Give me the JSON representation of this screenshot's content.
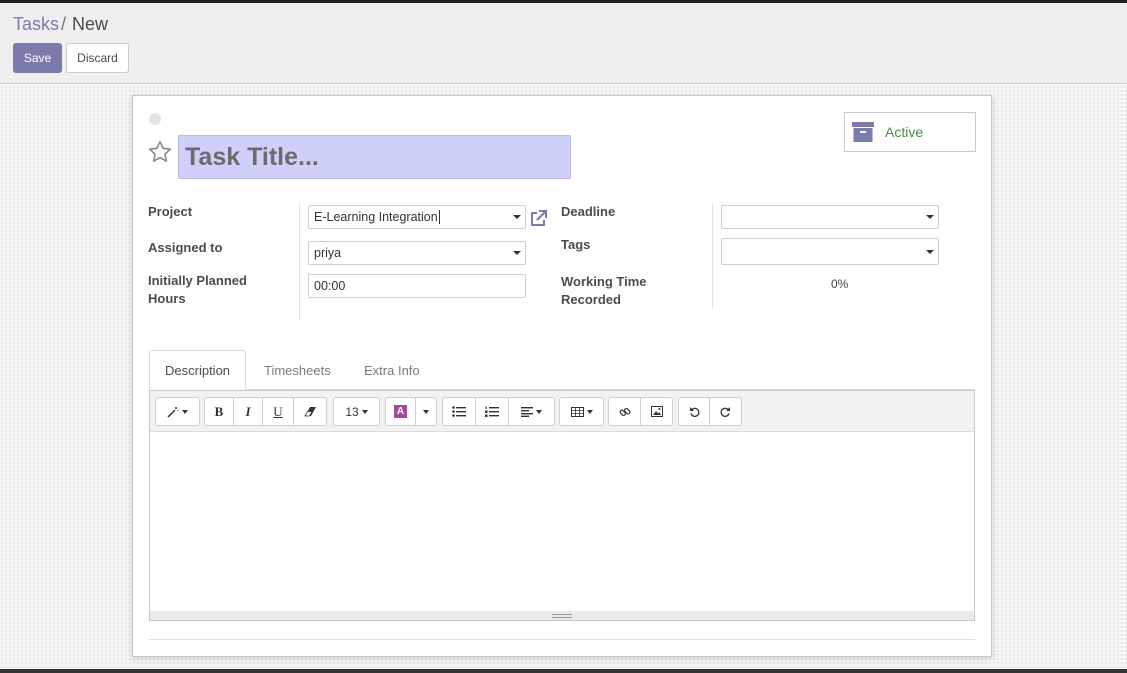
{
  "breadcrumb": {
    "parent": "Tasks",
    "separator": "/",
    "current": "New"
  },
  "buttons": {
    "save": "Save",
    "discard": "Discard"
  },
  "title": {
    "placeholder": "Task Title..."
  },
  "archive": {
    "label": "Active"
  },
  "fields": {
    "project": {
      "label": "Project",
      "value": "E-Learning Integration"
    },
    "assigned_to": {
      "label": "Assigned to",
      "value": "priya"
    },
    "planned_hours": {
      "label_line1": "Initially Planned",
      "label_line2": "Hours",
      "value": "00:00"
    },
    "deadline": {
      "label": "Deadline",
      "value": ""
    },
    "tags": {
      "label": "Tags",
      "value": ""
    },
    "working_time": {
      "label_line1": "Working Time",
      "label_line2": "Recorded",
      "value": "0%"
    }
  },
  "tabs": [
    "Description",
    "Timesheets",
    "Extra Info"
  ],
  "toolbar": {
    "style_icon": "magic-wand-icon",
    "bold": "B",
    "italic": "I",
    "underline": "U",
    "eraser_icon": "eraser-icon",
    "font_size": "13",
    "color_letter": "A",
    "icons": [
      "unordered-list-icon",
      "ordered-list-icon",
      "align-icon",
      "table-icon",
      "link-icon",
      "image-icon",
      "undo-icon",
      "redo-icon"
    ]
  },
  "colors": {
    "accent": "#7c7bad",
    "title_bg": "#cfd0fa",
    "active_green": "#4a8d42"
  }
}
